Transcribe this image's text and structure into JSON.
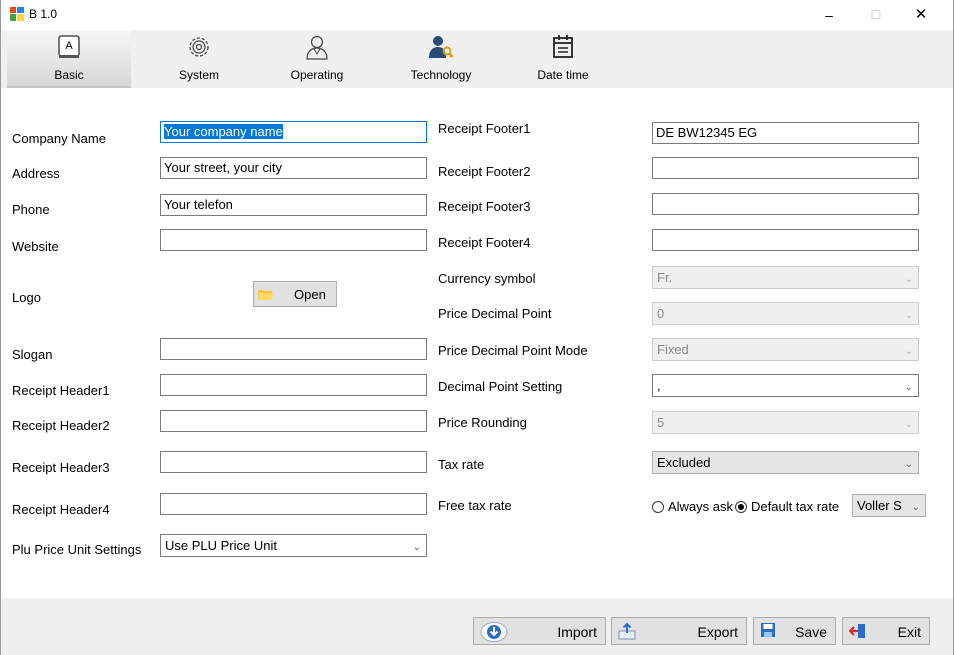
{
  "window": {
    "title": "B 1.0",
    "minimize": "–",
    "maximize": "☐",
    "close": "✕"
  },
  "toolbar": {
    "tabs": [
      {
        "label": "Basic",
        "icon": "keyboard-key-icon",
        "active": true
      },
      {
        "label": "System",
        "icon": "gear-icon",
        "active": false
      },
      {
        "label": "Operating",
        "icon": "user-icon",
        "active": false
      },
      {
        "label": "Technology",
        "icon": "user-key-icon",
        "active": false
      },
      {
        "label": "Date time",
        "icon": "calendar-icon",
        "active": false
      }
    ],
    "basic_key_glyph": "A"
  },
  "left_form": {
    "company_name": {
      "label": "Company Name",
      "value": "Your company name"
    },
    "address": {
      "label": "Address",
      "value": "Your street, your city"
    },
    "phone": {
      "label": "Phone",
      "value": "Your telefon"
    },
    "website": {
      "label": "Website",
      "value": ""
    },
    "logo": {
      "label": "Logo",
      "button": "Open"
    },
    "slogan": {
      "label": "Slogan",
      "value": ""
    },
    "receipt_header1": {
      "label": "Receipt Header1",
      "value": ""
    },
    "receipt_header2": {
      "label": "Receipt Header2",
      "value": ""
    },
    "receipt_header3": {
      "label": "Receipt Header3",
      "value": ""
    },
    "receipt_header4": {
      "label": "Receipt Header4",
      "value": ""
    },
    "plu_price_unit": {
      "label": "Plu Price Unit Settings",
      "value": "Use PLU Price Unit"
    }
  },
  "right_form": {
    "receipt_footer1": {
      "label": "Receipt Footer1",
      "value": "DE BW12345 EG"
    },
    "receipt_footer2": {
      "label": "Receipt Footer2",
      "value": ""
    },
    "receipt_footer3": {
      "label": "Receipt Footer3",
      "value": ""
    },
    "receipt_footer4": {
      "label": "Receipt Footer4",
      "value": ""
    },
    "currency_symbol": {
      "label": "Currency symbol",
      "value": "Fr."
    },
    "price_decimal_point": {
      "label": "Price Decimal Point",
      "value": "0"
    },
    "price_decimal_point_mode": {
      "label": "Price Decimal Point Mode",
      "value": "Fixed"
    },
    "decimal_point_setting": {
      "label": "Decimal Point Setting",
      "value": ","
    },
    "price_rounding": {
      "label": "Price Rounding",
      "value": "5"
    },
    "tax_rate": {
      "label": "Tax rate",
      "value": "Excluded"
    },
    "free_tax_rate": {
      "label": "Free tax rate",
      "option_always_ask": "Always ask",
      "option_default": "Default tax rate",
      "selected": "Default tax rate",
      "default_value": "Voller S"
    }
  },
  "bottom": {
    "import": "Import",
    "export": "Export",
    "save": "Save",
    "exit": "Exit"
  },
  "colors": {
    "selection": "#0078d7",
    "panel": "#f0f0f0",
    "button": "#e1e1e1"
  }
}
